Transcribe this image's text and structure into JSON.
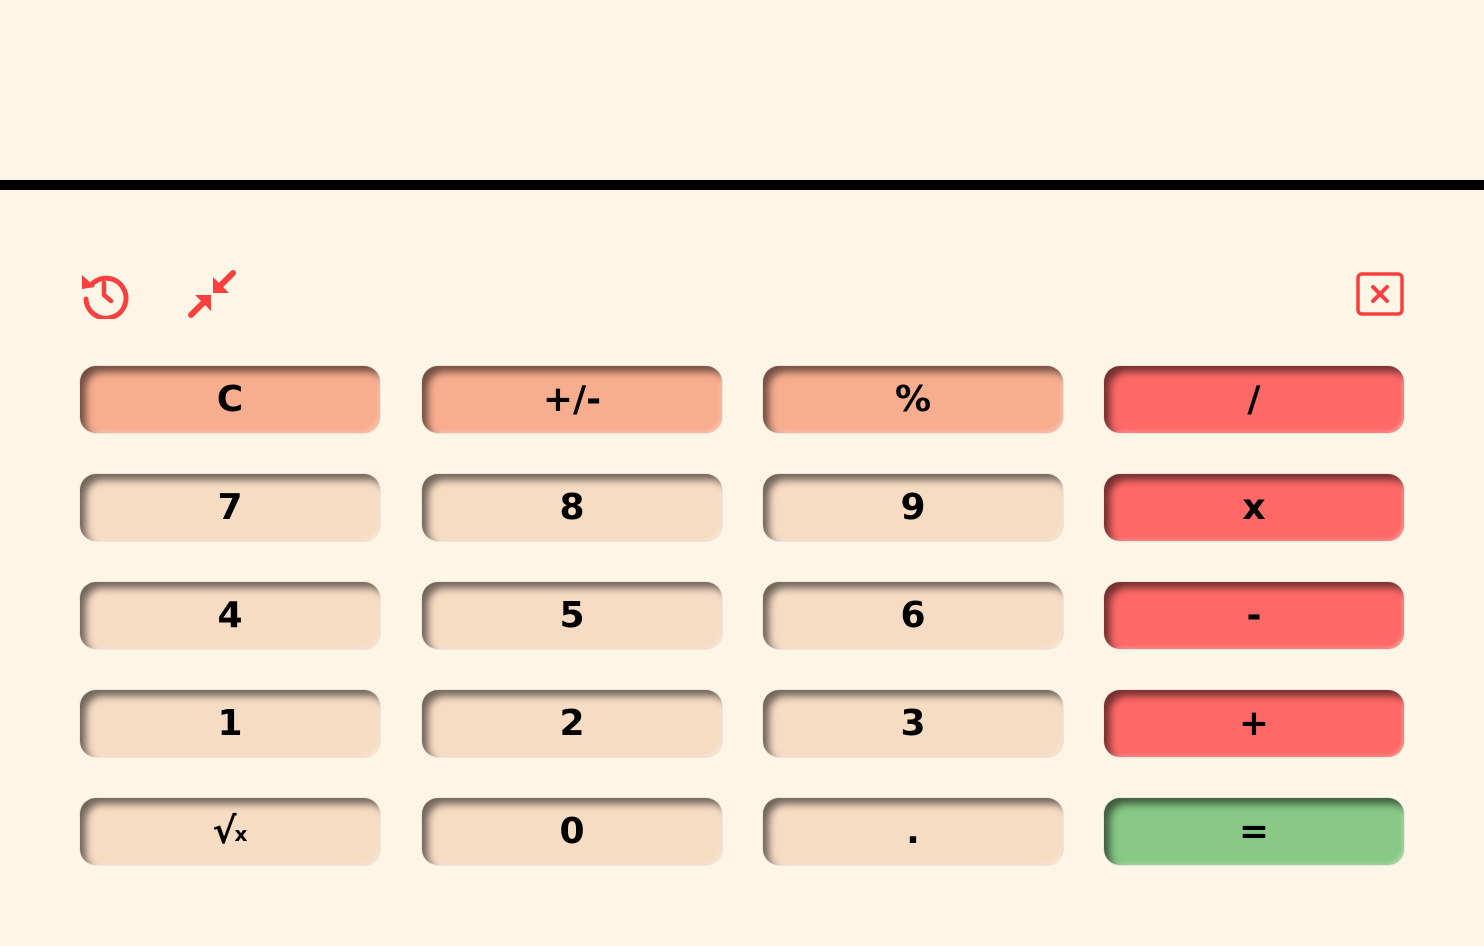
{
  "display": {
    "value": ""
  },
  "toolbar": {
    "history_icon": "history-icon",
    "collapse_icon": "collapse-arrows-icon",
    "backspace_icon": "close-box-icon",
    "accent_color": "#f9403f"
  },
  "keys": {
    "clear": "C",
    "negate": "+/-",
    "percent": "%",
    "divide": "/",
    "seven": "7",
    "eight": "8",
    "nine": "9",
    "multiply": "x",
    "four": "4",
    "five": "5",
    "six": "6",
    "subtract": "-",
    "one": "1",
    "two": "2",
    "three": "3",
    "add": "+",
    "sqrt_symbol": "√",
    "sqrt_var": "x",
    "zero": "0",
    "decimal": ".",
    "equals": "="
  },
  "colors": {
    "background": "#fdf5e6",
    "number_key": "#f7dcc4",
    "function_key": "#f9ad8f",
    "operator_key": "#fe6967",
    "equals_key": "#88c986"
  }
}
